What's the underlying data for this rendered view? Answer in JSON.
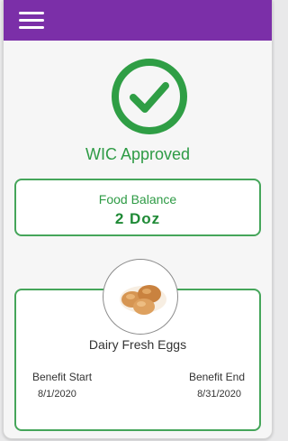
{
  "header": {
    "menu_icon": "hamburger-menu-icon",
    "background_color": "#7b2fa8"
  },
  "status": {
    "icon": "check-circle-icon",
    "text": "WIC Approved",
    "color": "#2e9b45"
  },
  "food_balance": {
    "label": "Food Balance",
    "value": "2 Doz"
  },
  "product": {
    "image": "eggs-image",
    "name": "Dairy Fresh Eggs",
    "benefit_start_label": "Benefit Start",
    "benefit_start_date": "8/1/2020",
    "benefit_end_label": "Benefit End",
    "benefit_end_date": "8/31/2020"
  }
}
